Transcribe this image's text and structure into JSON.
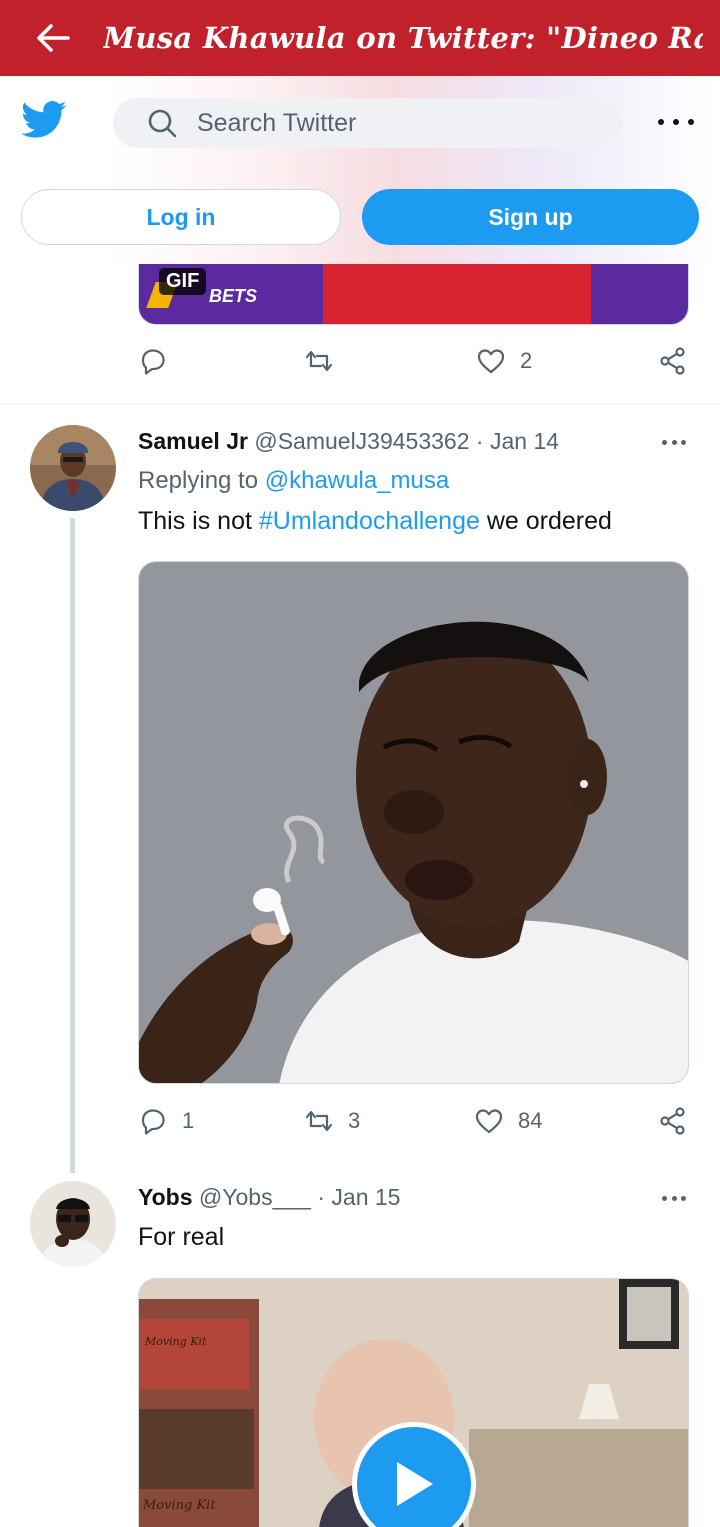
{
  "appbar": {
    "title": "Musa Khawula on Twitter: \"Dineo Ran..."
  },
  "header": {
    "search_placeholder": "Search Twitter",
    "login_label": "Log in",
    "signup_label": "Sign up"
  },
  "prev_tweet": {
    "gif_badge": "GIF",
    "media_text": "BETS",
    "likes": "2"
  },
  "tweets": [
    {
      "name": "Samuel Jr",
      "handle": "@SamuelJ39453362",
      "sep": "·",
      "date": "Jan 14",
      "replying_prefix": "Replying to",
      "replying_to": "@khawula_musa",
      "text_before": "This is not",
      "hashtag": "#Umlandochallenge",
      "text_after": "we ordered",
      "replies": "1",
      "retweets": "3",
      "likes": "84"
    },
    {
      "name": "Yobs",
      "handle": "@Yobs___",
      "sep": "·",
      "date": "Jan 15",
      "text": "For real",
      "media_label_1": "Moving Kit",
      "media_label_2": "Moving Kit"
    }
  ],
  "colors": {
    "appbar": "#c0212b",
    "twitter_blue": "#1d9bf0",
    "muted": "#536471"
  },
  "icons": [
    "back-arrow-icon",
    "twitter-bird-icon",
    "search-icon",
    "more-icon",
    "reply-icon",
    "retweet-icon",
    "like-icon",
    "share-icon",
    "play-icon"
  ]
}
